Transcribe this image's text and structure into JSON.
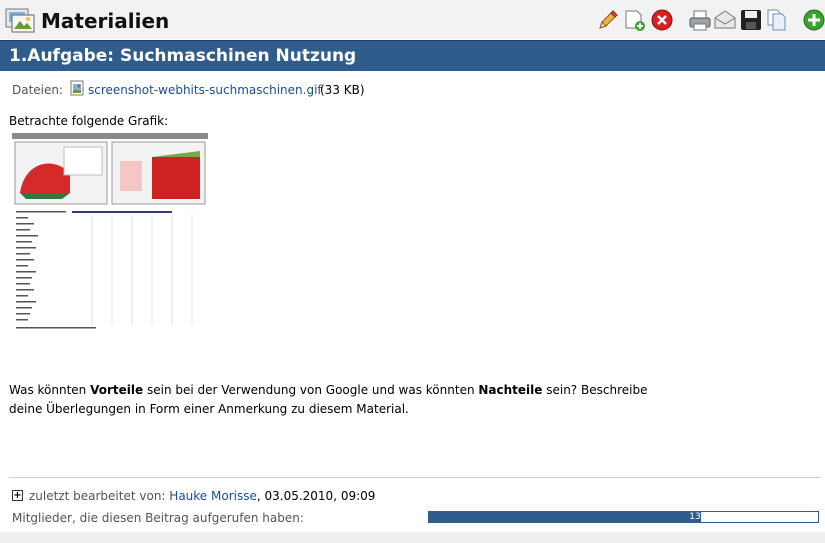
{
  "app": {
    "title": "Materialien"
  },
  "task": {
    "title": "1.Aufgabe: Suchmaschinen Nutzung"
  },
  "files": {
    "label": "Dateien:",
    "name": "screenshot-webhits-suchmaschinen.gif",
    "size": "(33 KB)"
  },
  "intro": "Betrachte folgende Grafik:",
  "question": {
    "part1": "Was könnten ",
    "bold1": "Vorteile",
    "part2": " sein bei der Verwendung von Google und was könnten ",
    "bold2": "Nachteile",
    "part3": " sein? Beschreibe deine Überlegungen in Form einer Anmerkung zu diesem Material."
  },
  "footer": {
    "edited_label": "zuletzt bearbeitet von:",
    "author": "Hauke Morisse",
    "date": ", 03.05.2010, 09:09",
    "viewers_label": "Mitglieder, die diesen Beitrag aufgerufen haben:",
    "viewers_count": "13",
    "viewers_fraction": 0.7
  },
  "toolbar": {
    "icons": [
      "edit-pencil-icon",
      "new-document-icon",
      "delete-icon",
      "print-icon",
      "mail-icon",
      "save-disk-icon",
      "copy-document-icon",
      "add-icon"
    ]
  },
  "colors": {
    "header": "#2f5c8a",
    "link": "#1b4f8e",
    "delete": "#d91f1f",
    "add": "#3aa32e"
  }
}
